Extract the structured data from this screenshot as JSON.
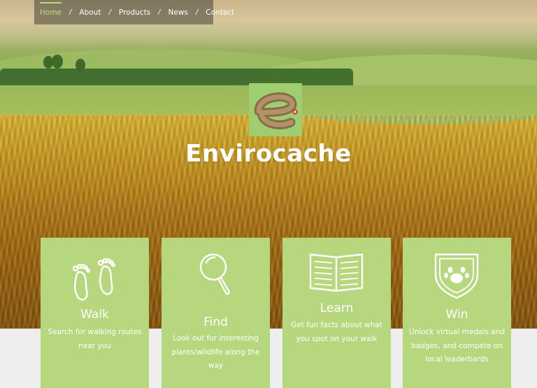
{
  "nav": {
    "items": [
      {
        "label": "Home",
        "active": true
      },
      {
        "label": "About",
        "active": false
      },
      {
        "label": "Products",
        "active": false
      },
      {
        "label": "News",
        "active": false
      },
      {
        "label": "Contact",
        "active": false
      }
    ],
    "separator": "/"
  },
  "brand": {
    "title": "Envirocache"
  },
  "features": [
    {
      "icon": "footprints-icon",
      "title": "Walk",
      "description": "Search for walking routes near you"
    },
    {
      "icon": "magnifier-icon",
      "title": "Find",
      "description": "Look out for interesting plants/wildlife along the way"
    },
    {
      "icon": "open-book-icon",
      "title": "Learn",
      "description": "Get fun facts about what you spot on your walk"
    },
    {
      "icon": "paw-shield-icon",
      "title": "Win",
      "description": "Unlock virtual medals and badges, and compete on local leaderbards"
    }
  ],
  "colors": {
    "accent": "#b6d77d",
    "nav_active": "#b7e07a",
    "nav_bg": "#55504a"
  }
}
